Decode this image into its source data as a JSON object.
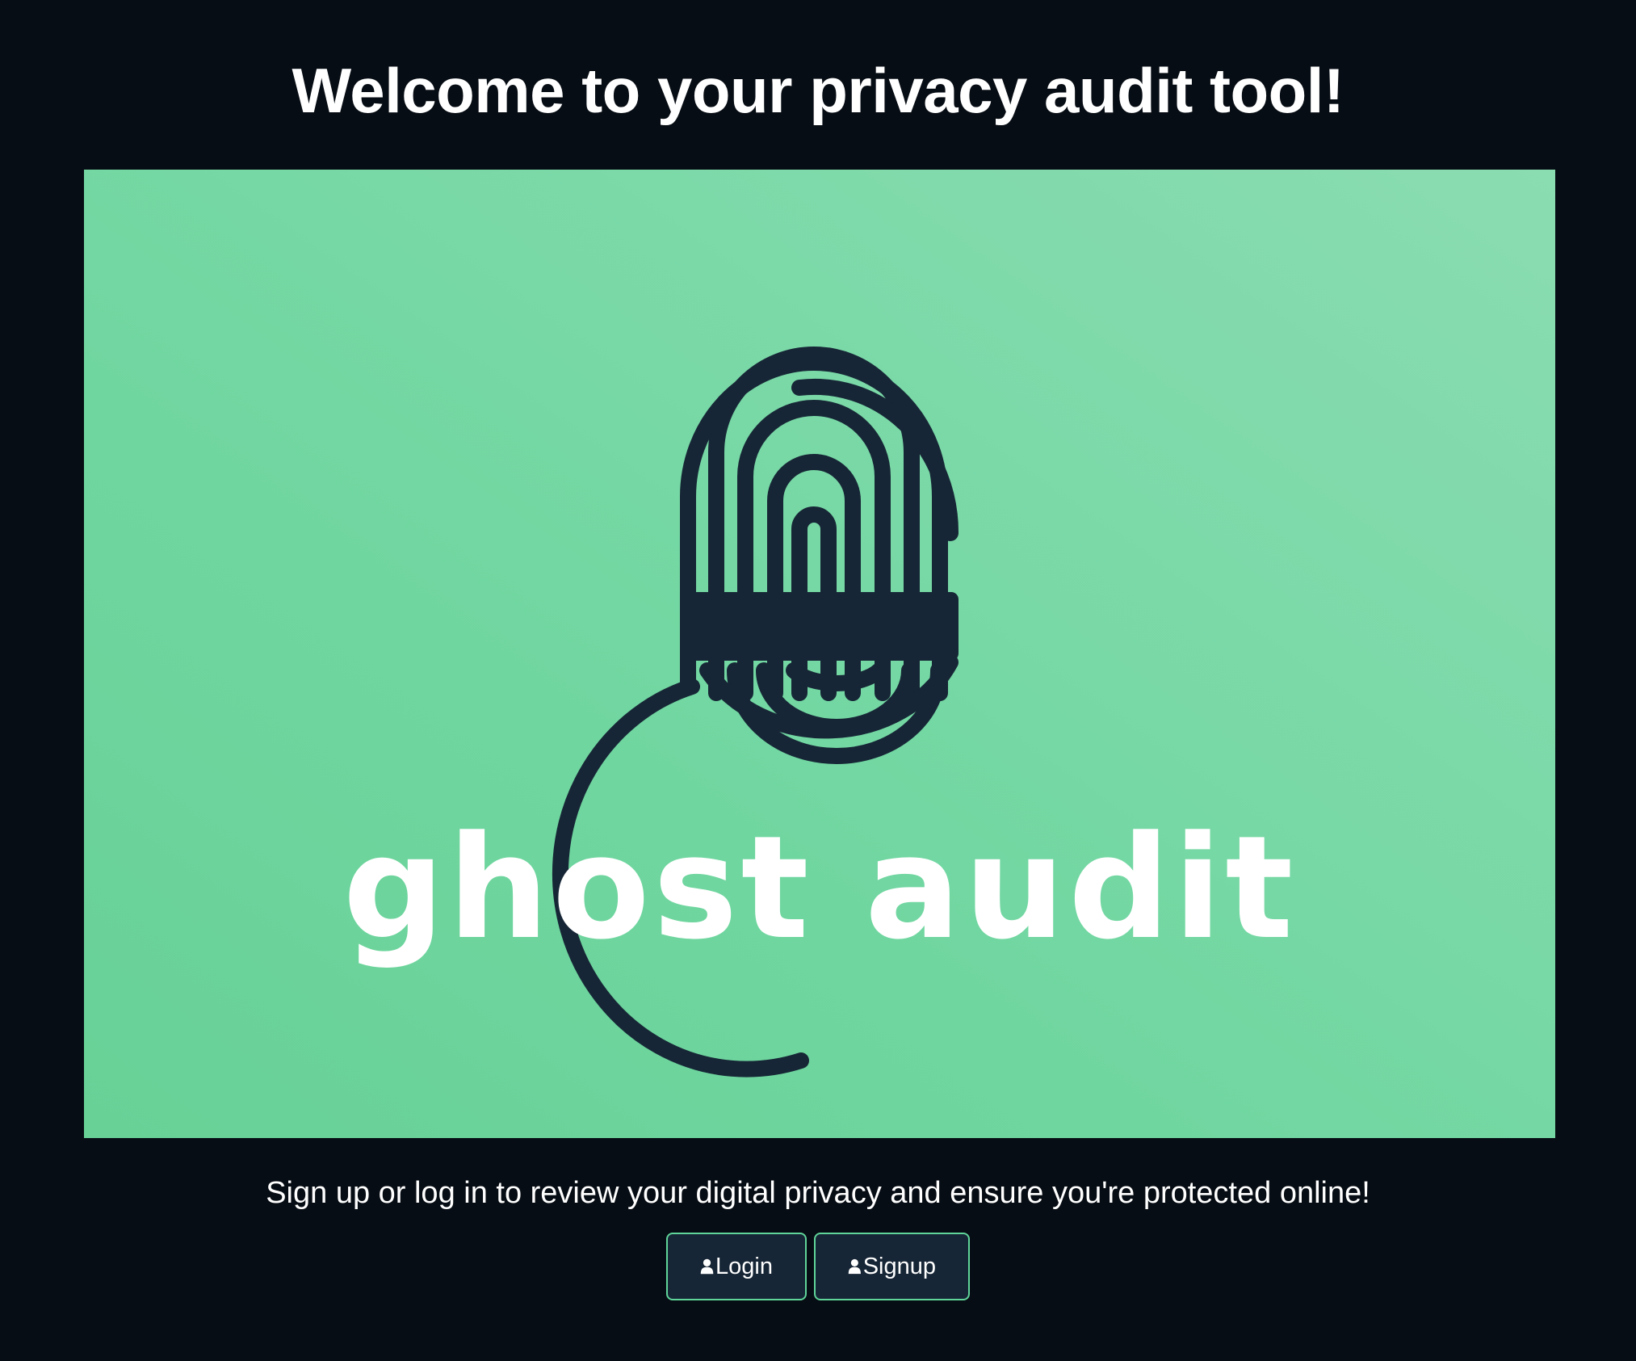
{
  "header": {
    "title": "Welcome to your privacy audit tool!"
  },
  "hero": {
    "logo_text": "ghost audit",
    "logo_icon": "fingerprint-lock-icon",
    "colors": {
      "background": "#6dd49c",
      "mark": "#172636",
      "text": "#ffffff"
    }
  },
  "intro": {
    "text": "Sign up or log in to review your digital privacy and ensure you're protected online!"
  },
  "actions": {
    "login_label": "Login",
    "signup_label": "Signup",
    "button_icon": "user-icon"
  },
  "theme": {
    "page_background": "#070d14",
    "button_background": "#172636",
    "button_border": "#5fd59a"
  }
}
